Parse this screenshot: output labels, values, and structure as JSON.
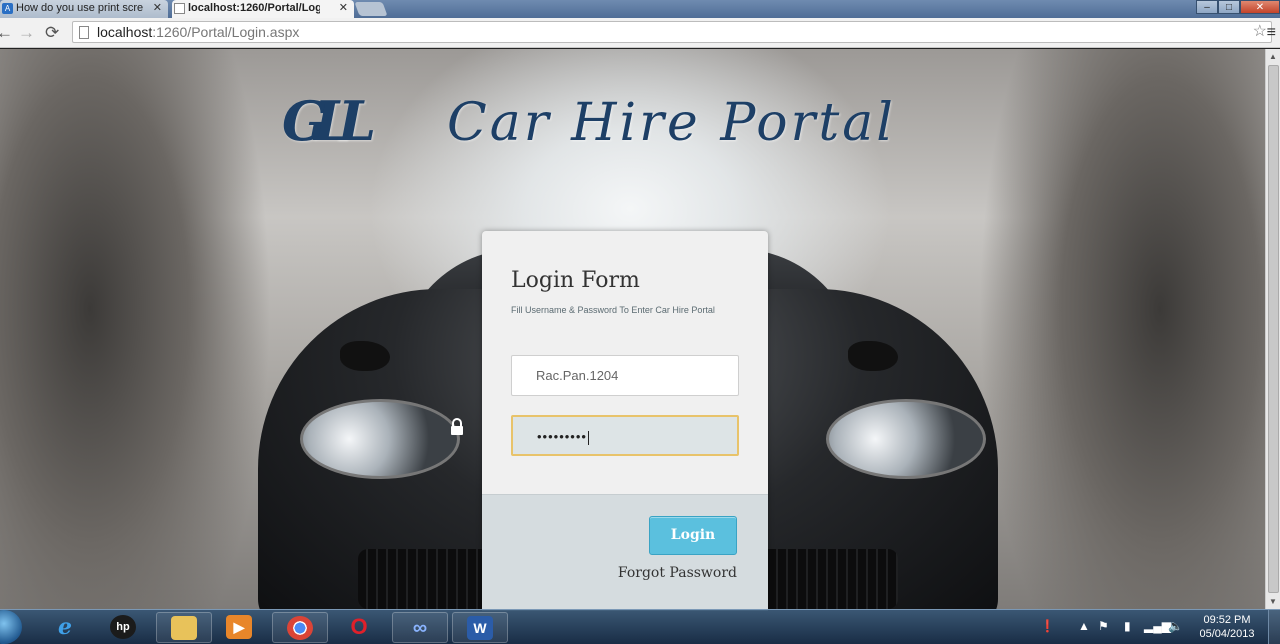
{
  "browser": {
    "tabs": [
      {
        "label": "How do you use print scre",
        "active": false
      },
      {
        "label": "localhost:1260/Portal/Log",
        "active": true
      }
    ],
    "address": {
      "host": "localhost",
      "rest": ":1260/Portal/Login.aspx"
    }
  },
  "page": {
    "logo_mark": "GLL",
    "logo_text": "Car Hire Portal",
    "form": {
      "title": "Login Form",
      "subtitle": "Fill Username & Password To Enter Car Hire Portal",
      "username_value": "Rac.Pan.1204",
      "password_value": "•••••••••",
      "login_label": "Login",
      "forgot_label": "Forgot Password"
    }
  },
  "taskbar": {
    "apps": [
      "internet-explorer",
      "hp",
      "file-explorer",
      "media-player",
      "chrome",
      "opera",
      "infinity",
      "word"
    ],
    "time": "09:52 PM",
    "date": "05/04/2013"
  },
  "colors": {
    "brand": "#1d3f66",
    "button": "#5bc0de",
    "focus_border": "#e8c36a"
  }
}
